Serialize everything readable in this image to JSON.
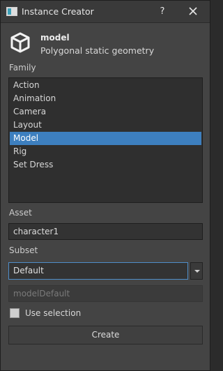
{
  "window": {
    "title": "Instance Creator",
    "help_label": "?",
    "close_icon": "close-icon"
  },
  "header": {
    "icon": "cube-icon",
    "family_name": "model",
    "family_description": "Polygonal static geometry"
  },
  "family": {
    "label": "Family",
    "items": [
      "Action",
      "Animation",
      "Camera",
      "Layout",
      "Model",
      "Rig",
      "Set Dress"
    ],
    "selected": "Model"
  },
  "asset": {
    "label": "Asset",
    "value": "character1"
  },
  "subset": {
    "label": "Subset",
    "selected": "Default",
    "result": "modelDefault"
  },
  "options": {
    "use_selection_label": "Use selection",
    "use_selection_checked": false
  },
  "actions": {
    "create_label": "Create"
  },
  "colors": {
    "window_bg": "#444444",
    "list_bg": "#2f2f2f",
    "selection": "#3d7fbf",
    "focus_border": "#4f8ec9"
  }
}
